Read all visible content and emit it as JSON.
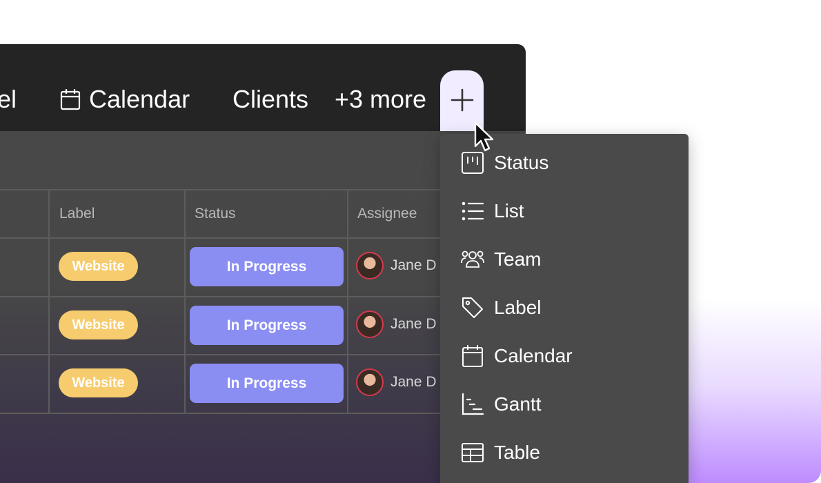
{
  "topbar": {
    "tabs": [
      {
        "label": "el"
      },
      {
        "label": "Calendar",
        "icon": "calendar-icon"
      },
      {
        "label": "Clients"
      },
      {
        "label": "+3 more"
      }
    ],
    "add_icon": "plus-icon"
  },
  "table": {
    "headers": [
      "Label",
      "Status",
      "Assignee"
    ],
    "rows": [
      {
        "label": "Website",
        "status": "In Progress",
        "assignee": "Jane D"
      },
      {
        "label": "Website",
        "status": "In Progress",
        "assignee": "Jane D"
      },
      {
        "label": "Website",
        "status": "In Progress",
        "assignee": "Jane D"
      }
    ]
  },
  "dropdown": {
    "items": [
      {
        "label": "Status",
        "icon": "status-board-icon"
      },
      {
        "label": "List",
        "icon": "list-icon"
      },
      {
        "label": "Team",
        "icon": "team-icon"
      },
      {
        "label": "Label",
        "icon": "tag-icon"
      },
      {
        "label": "Calendar",
        "icon": "calendar-icon"
      },
      {
        "label": "Gantt",
        "icon": "gantt-icon"
      },
      {
        "label": "Table",
        "icon": "table-icon"
      }
    ]
  },
  "colors": {
    "topbar": "#242424",
    "panel": "#484848",
    "label_pill": "#f6cc6e",
    "status_pill": "#8a8df2",
    "add_button": "#f1ecff",
    "dropdown": "#4a4a4a"
  }
}
